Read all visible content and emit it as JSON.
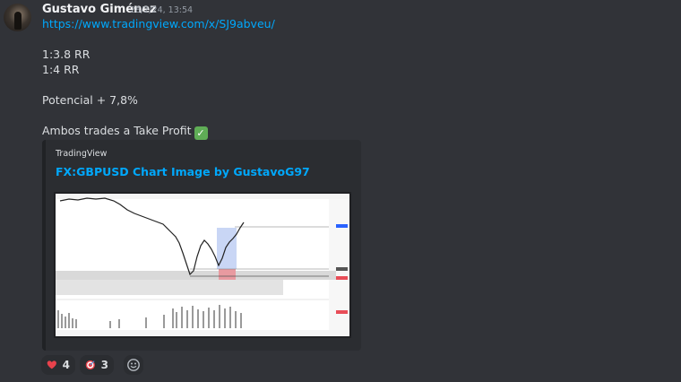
{
  "message": {
    "author": "Gustavo Giménez",
    "timestamp": "28/2/24, 13:54",
    "link": "https://www.tradingview.com/x/SJ9abveu/",
    "lines": [
      "1:3.8 RR",
      "1:4 RR",
      "Potencial + 7,8%",
      "Ambos trades a Take Profit"
    ],
    "check_emoji": "✓"
  },
  "embed": {
    "provider": "TradingView",
    "title": "FX:GBPUSD Chart Image by GustavoG97"
  },
  "reactions": [
    {
      "icon": "heart-icon",
      "count": "4"
    },
    {
      "icon": "target-icon",
      "count": "3"
    }
  ],
  "colors": {
    "background": "#313338",
    "link": "#00a8fc",
    "embed_bg": "#2b2d31",
    "heart": "#e8424c",
    "check": "#5fad56"
  }
}
